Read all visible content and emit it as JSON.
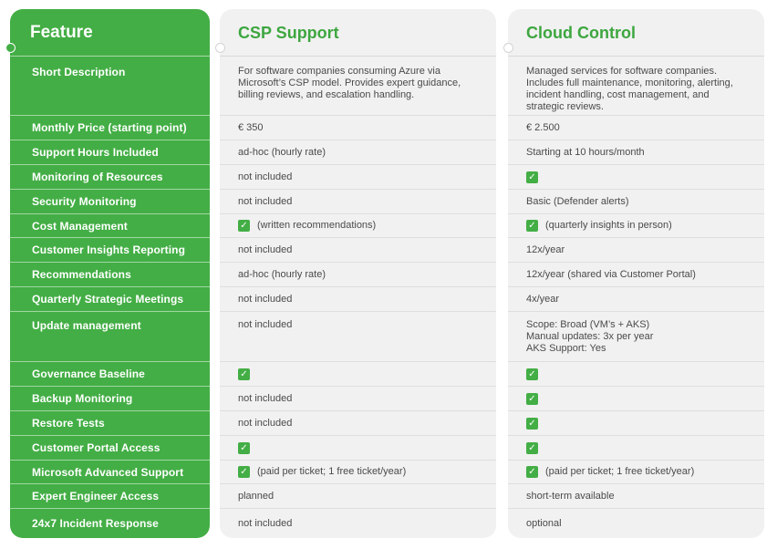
{
  "accent_color": "#43ae45",
  "columns": {
    "feature": "Feature",
    "csp": "CSP Support",
    "cloud": "Cloud Control"
  },
  "rows": [
    {
      "feature": "Short Description",
      "csp": {
        "check": false,
        "text": "For software companies consuming Azure via\nMicrosoft’s CSP model. Provides expert guidance,\nbilling reviews, and escalation handling."
      },
      "cloud": {
        "check": false,
        "text": "Managed services for software companies.\nIncludes full maintenance, monitoring, alerting,\nincident handling, cost management, and\nstrategic reviews."
      }
    },
    {
      "feature": "Monthly Price (starting point)",
      "csp": {
        "check": false,
        "text": "€ 350"
      },
      "cloud": {
        "check": false,
        "text": "€ 2.500"
      }
    },
    {
      "feature": "Support Hours Included",
      "csp": {
        "check": false,
        "text": "ad-hoc (hourly rate)"
      },
      "cloud": {
        "check": false,
        "text": "Starting at 10 hours/month"
      }
    },
    {
      "feature": "Monitoring of Resources",
      "csp": {
        "check": false,
        "text": "not included"
      },
      "cloud": {
        "check": true,
        "text": ""
      }
    },
    {
      "feature": "Security Monitoring",
      "csp": {
        "check": false,
        "text": "not included"
      },
      "cloud": {
        "check": false,
        "text": "Basic (Defender alerts)"
      }
    },
    {
      "feature": "Cost Management",
      "csp": {
        "check": true,
        "text": "(written recommendations)"
      },
      "cloud": {
        "check": true,
        "text": "(quarterly insights in person)"
      }
    },
    {
      "feature": "Customer Insights Reporting",
      "csp": {
        "check": false,
        "text": "not included"
      },
      "cloud": {
        "check": false,
        "text": "12x/year"
      }
    },
    {
      "feature": "Recommendations",
      "csp": {
        "check": false,
        "text": "ad-hoc (hourly rate)"
      },
      "cloud": {
        "check": false,
        "text": "12x/year (shared via Customer Portal)"
      }
    },
    {
      "feature": "Quarterly Strategic Meetings",
      "csp": {
        "check": false,
        "text": "not included"
      },
      "cloud": {
        "check": false,
        "text": "4x/year"
      }
    },
    {
      "feature": "Update management",
      "csp": {
        "check": false,
        "text": "not included"
      },
      "cloud": {
        "check": false,
        "text": "Scope: Broad (VM’s + AKS)\nManual updates: 3x per year\nAKS Support: Yes"
      }
    },
    {
      "feature": "Governance Baseline",
      "csp": {
        "check": true,
        "text": ""
      },
      "cloud": {
        "check": true,
        "text": ""
      }
    },
    {
      "feature": "Backup Monitoring",
      "csp": {
        "check": false,
        "text": "not included"
      },
      "cloud": {
        "check": true,
        "text": ""
      }
    },
    {
      "feature": "Restore Tests",
      "csp": {
        "check": false,
        "text": "not included"
      },
      "cloud": {
        "check": true,
        "text": ""
      }
    },
    {
      "feature": "Customer Portal Access",
      "csp": {
        "check": true,
        "text": ""
      },
      "cloud": {
        "check": true,
        "text": ""
      }
    },
    {
      "feature": "Microsoft Advanced Support",
      "csp": {
        "check": true,
        "text": "(paid per ticket; 1 free ticket/year)"
      },
      "cloud": {
        "check": true,
        "text": "(paid per ticket; 1 free ticket/year)"
      }
    },
    {
      "feature": "Expert Engineer Access",
      "csp": {
        "check": false,
        "text": "planned"
      },
      "cloud": {
        "check": false,
        "text": "short-term available"
      }
    },
    {
      "feature": "24x7 Incident Response",
      "csp": {
        "check": false,
        "text": "not included"
      },
      "cloud": {
        "check": false,
        "text": "optional"
      }
    }
  ]
}
